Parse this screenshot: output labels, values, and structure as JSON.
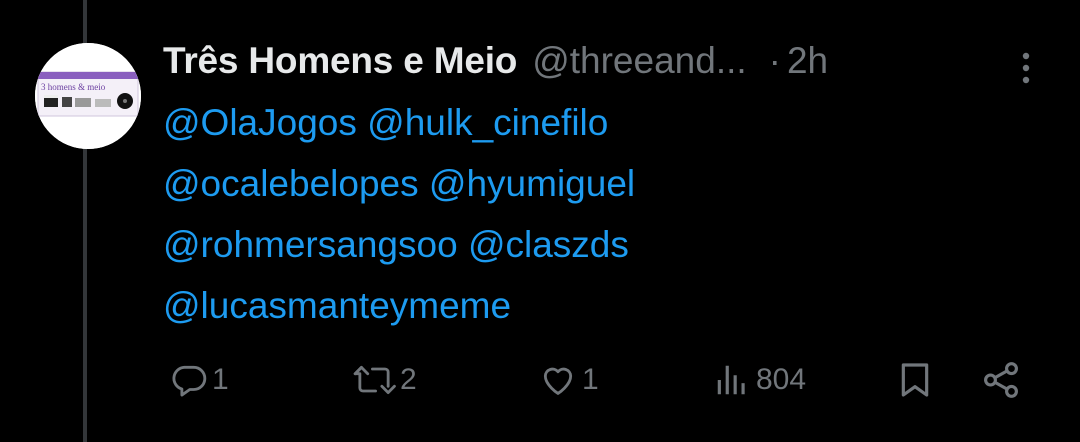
{
  "author": {
    "display_name": "Três Homens e Meio",
    "handle": "@threeand...",
    "separator": "·",
    "timestamp": "2h",
    "avatar_text": "3 homens & meio"
  },
  "tweet": {
    "lines": [
      [
        "@OlaJogos",
        "@hulk_cinefilo"
      ],
      [
        "@ocalebelopes",
        "@hyumiguel"
      ],
      [
        "@rohmersangsoo",
        "@claszds"
      ],
      [
        "@lucasmanteymeme"
      ]
    ]
  },
  "actions": {
    "reply_count": "1",
    "retweet_count": "2",
    "like_count": "1",
    "views_count": "804"
  },
  "icons": {
    "more": "more-vertical-icon",
    "reply": "reply-icon",
    "retweet": "retweet-icon",
    "like": "heart-icon",
    "views": "views-chart-icon",
    "bookmark": "bookmark-icon",
    "share": "share-icon"
  },
  "colors": {
    "background": "#000000",
    "primary_text": "#e7e9ea",
    "secondary_text": "#71767b",
    "link": "#1d9bf0",
    "thread_line": "#333639"
  }
}
